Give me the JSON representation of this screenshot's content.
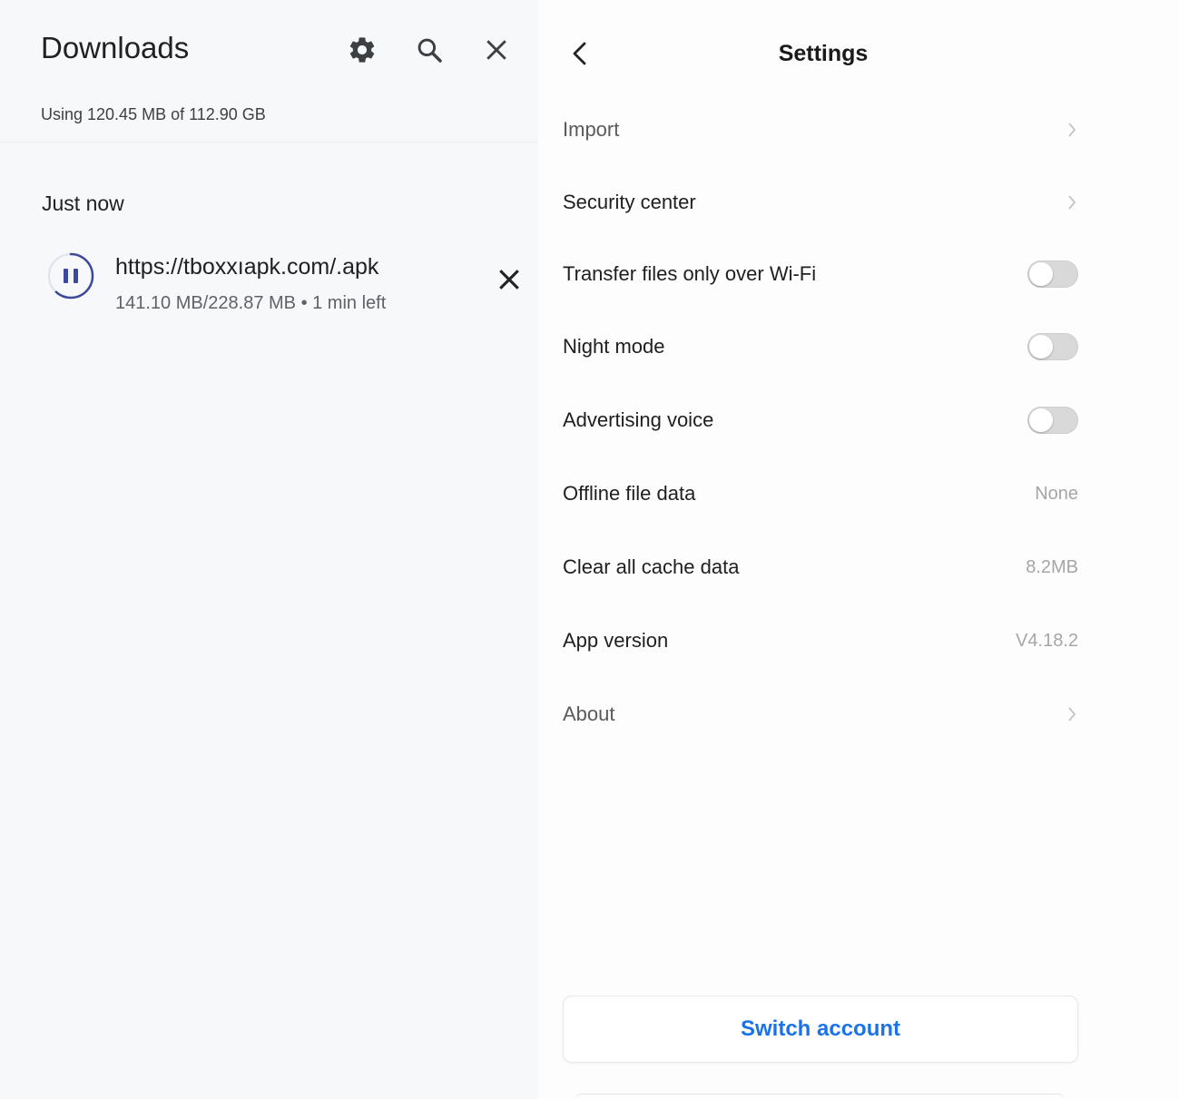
{
  "downloads": {
    "title": "Downloads",
    "storage_text": "Using 120.45 MB of 112.90 GB",
    "section_label": "Just now",
    "item": {
      "url": "https://tboxxıapk.com/.apk",
      "meta": "141.10 MB/228.87 MB • 1 min left",
      "progress_fraction": 0.617
    },
    "icons": {
      "settings": "gear-icon",
      "search": "search-icon",
      "close": "close-icon",
      "pause": "pause-icon",
      "cancel": "cancel-icon"
    }
  },
  "settings": {
    "title": "Settings",
    "rows": [
      {
        "label": "Import",
        "control": "chevron"
      },
      {
        "label": "Security center",
        "control": "chevron"
      },
      {
        "label": "Transfer files only over Wi-Fi",
        "control": "toggle",
        "on": false
      },
      {
        "label": "Night mode",
        "control": "toggle",
        "on": false
      },
      {
        "label": "Advertising voice",
        "control": "toggle",
        "on": false
      },
      {
        "label": "Offline file data",
        "value": "None"
      },
      {
        "label": "Clear all cache data",
        "value": "8.2MB"
      },
      {
        "label": "App version",
        "value": "V4.18.2"
      },
      {
        "label": "About",
        "control": "chevron"
      }
    ],
    "switch_account_label": "Switch account"
  },
  "colors": {
    "accent": "#1a73e8",
    "progress_ring": "#3b4a9c",
    "toggle_off": "#d9d9d9"
  }
}
